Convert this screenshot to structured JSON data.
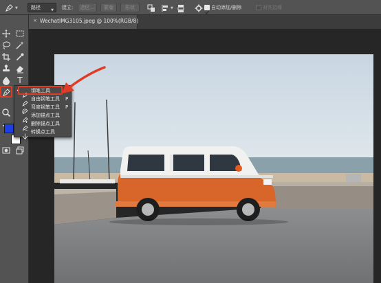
{
  "options_bar": {
    "mode_value": "路径",
    "build_label": "建立:",
    "selection_btn": "选区...",
    "mask_btn": "蒙版",
    "shape_btn": "形状",
    "auto_add_delete_label": "自动添加/删除",
    "auto_add_delete_checked": true,
    "align_edges_label": "对齐边缘",
    "align_edges_checked": false
  },
  "document_tab": {
    "close_glyph": "×",
    "title": "WechatIMG3105.jpeg @ 100%(RGB/8)"
  },
  "toolbar": {
    "type_tool_glyph": "T",
    "foreground_color": "#1f3fe6",
    "background_color": "#ffffff"
  },
  "pen_flyout": {
    "items": [
      {
        "label": "钢笔工具",
        "shortcut": "",
        "selected": true,
        "icon": "pen-icon"
      },
      {
        "label": "自由钢笔工具",
        "shortcut": "P",
        "selected": false,
        "icon": "freeform-pen-icon"
      },
      {
        "label": "弯度钢笔工具",
        "shortcut": "P",
        "selected": false,
        "icon": "curvature-pen-icon"
      },
      {
        "label": "添加锚点工具",
        "shortcut": "",
        "selected": false,
        "icon": "add-anchor-icon"
      },
      {
        "label": "删除锚点工具",
        "shortcut": "",
        "selected": false,
        "icon": "delete-anchor-icon"
      },
      {
        "label": "转换点工具",
        "shortcut": "",
        "selected": false,
        "icon": "convert-point-icon"
      }
    ],
    "selected_marker": "•"
  },
  "annotation": {
    "color": "#e23b25"
  },
  "photo": {
    "van_color": "#d8652a",
    "sky_color": "#d3dde6"
  }
}
